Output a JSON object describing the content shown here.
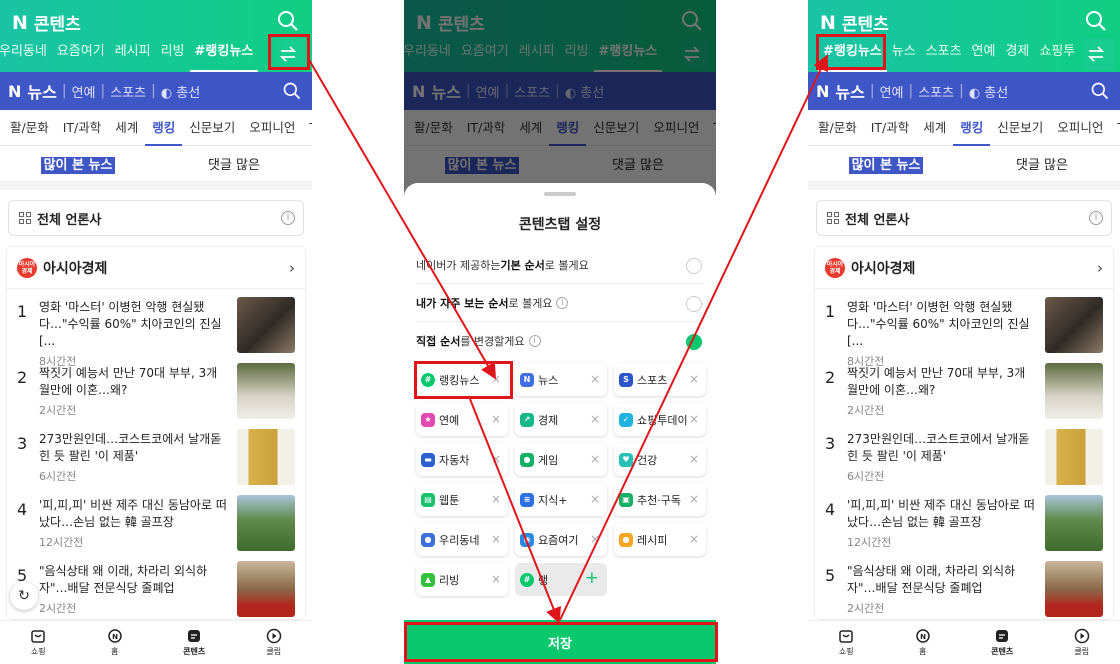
{
  "app": {
    "brand": "콘텐츠",
    "brand_letter": "N"
  },
  "screen1": {
    "content_tabs": [
      "우리동네",
      "요즘여기",
      "레시피",
      "리빙",
      "#랭킹뉴스"
    ],
    "active_tab": "#랭킹뉴스"
  },
  "screen3": {
    "content_tabs": [
      "#랭킹뉴스",
      "뉴스",
      "스포츠",
      "연예",
      "경제",
      "쇼핑투"
    ],
    "active_tab": "#랭킹뉴스"
  },
  "news": {
    "logo_letter": "N",
    "title": "뉴스",
    "sub1": "연예",
    "sub2": "스포츠",
    "sub3": "총선",
    "categories": [
      "활/문화",
      "IT/과학",
      "세계",
      "랭킹",
      "신문보기",
      "오피니언",
      "T"
    ],
    "active_category": "랭킹",
    "subtab_most_viewed": "많이 본 뉴스",
    "subtab_comments": "댓글 많은",
    "all_press": "전체 언론사",
    "press_name": "아시아경제",
    "press_icon_text": "아시아 경제",
    "articles": [
      {
        "num": "1",
        "title": "영화 '마스터' 이병헌 악행 현실됐다…\"수익률 60%\" 치아코인의 진실[...",
        "time": "8시간전"
      },
      {
        "num": "2",
        "title": "짝짓기 예능서 만난 70대 부부, 3개월만에 이혼…왜?",
        "time": "2시간전"
      },
      {
        "num": "3",
        "title": "273만원인데…코스트코에서 날개돋힌 듯 팔린 '이 제품'",
        "time": "6시간전"
      },
      {
        "num": "4",
        "title": "'피,피,피' 비싼 제주 대신 동남아로 떠났다…손님 없는 韓 골프장",
        "time": "12시간전"
      },
      {
        "num": "5",
        "title": "\"음식상태 왜 이래, 차라리 외식하자\"…배달 전문식당 줄폐업",
        "time": "2시간전"
      }
    ]
  },
  "bottom_nav": [
    {
      "label": "쇼핑",
      "icon": "shopping-bag-icon"
    },
    {
      "label": "홈",
      "icon": "home-n-icon"
    },
    {
      "label": "콘텐츠",
      "icon": "contents-icon"
    },
    {
      "label": "클립",
      "icon": "clip-play-icon"
    }
  ],
  "sheet": {
    "title": "콘텐츠탭 설정",
    "option1_pre": "네이버가 제공하는 ",
    "option1_bold": "기본 순서",
    "option1_post": "로 볼게요",
    "option2_bold": "내가 자주 보는 순서",
    "option2_post": "로 볼게요",
    "option3_bold": "직접 순서",
    "option3_post": "를 변경할게요",
    "chips": [
      {
        "label": "랭킹뉴스",
        "icon": "#",
        "color": "#08c86e"
      },
      {
        "label": "뉴스",
        "icon": "N",
        "color": "#3f6fe0"
      },
      {
        "label": "스포츠",
        "icon": "S",
        "color": "#2b55c9"
      },
      {
        "label": "연예",
        "icon": "★",
        "color": "#e04ab0"
      },
      {
        "label": "경제",
        "icon": "↗",
        "color": "#19b88a"
      },
      {
        "label": "쇼핑투데이",
        "icon": "✓",
        "color": "#1fb3e0"
      },
      {
        "label": "자동차",
        "icon": "▬",
        "color": "#2c5fd0"
      },
      {
        "label": "게임",
        "icon": "●",
        "color": "#15b067"
      },
      {
        "label": "건강",
        "icon": "♥",
        "color": "#27c2b5"
      },
      {
        "label": "웹툰",
        "icon": "▤",
        "color": "#17c26b"
      },
      {
        "label": "지식+",
        "icon": "≡",
        "color": "#2c6fe0"
      },
      {
        "label": "추천·구독",
        "icon": "▣",
        "color": "#17b067"
      },
      {
        "label": "우리동네",
        "icon": "●",
        "color": "#3c6fd8"
      },
      {
        "label": "요즘여기",
        "icon": "◉",
        "color": "#2a8ae0"
      },
      {
        "label": "레시피",
        "icon": "●",
        "color": "#f5a623"
      },
      {
        "label": "리빙",
        "icon": "▲",
        "color": "#32c03a"
      },
      {
        "label": "랭",
        "icon": "#",
        "color": "#08c86e"
      }
    ],
    "save": "저장"
  },
  "colors": {
    "brand_green": "#08c86e",
    "news_blue": "#3f57c6",
    "highlight_red": "#e0141b"
  }
}
